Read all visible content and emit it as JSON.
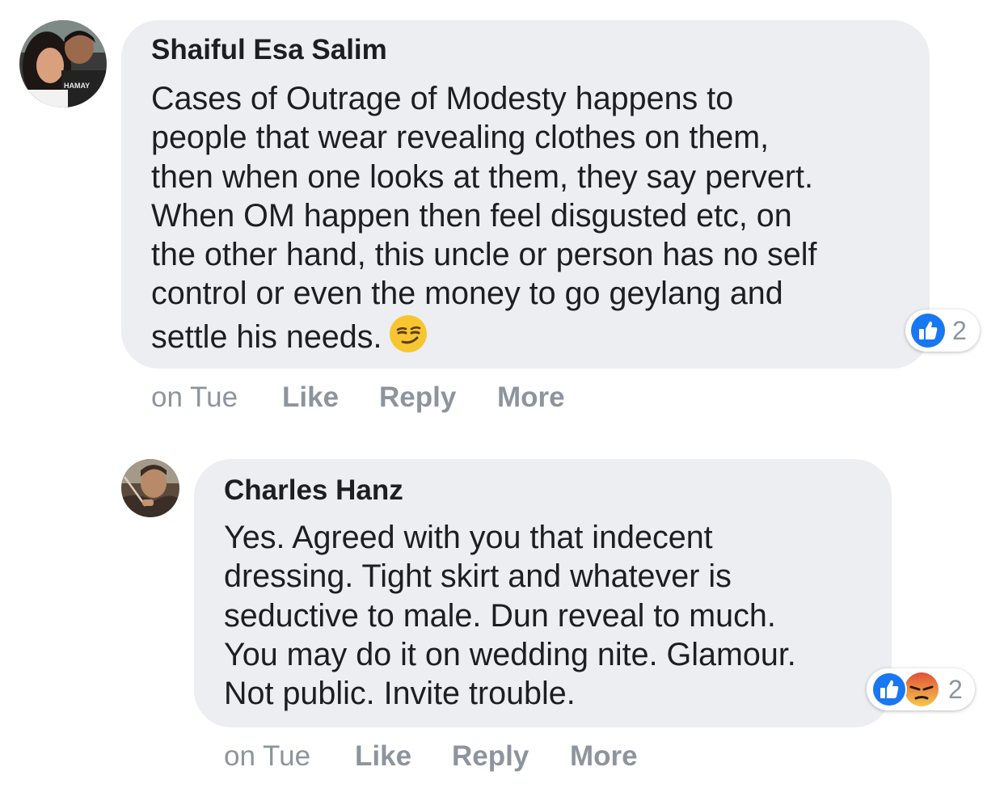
{
  "comments": [
    {
      "author": "Shaiful Esa Salim",
      "text_lines": [
        "Cases of Outrage of Modesty happens to",
        "people that wear revealing clothes on them,",
        "then when one looks at them, they say pervert.",
        "When OM happen then feel disgusted etc, on",
        "the other hand, this uncle or person has no self",
        "control or even the money to go geylang and",
        "settle his needs."
      ],
      "emoji": "smirking-face-emoji",
      "avatar_text": "HAMAY",
      "reactions": {
        "icons": [
          "like-icon"
        ],
        "count": "2"
      },
      "timestamp": "on Tue",
      "actions": {
        "like": "Like",
        "reply": "Reply",
        "more": "More"
      }
    },
    {
      "author": "Charles Hanz",
      "text_lines": [
        "Yes. Agreed with you that indecent",
        "dressing. Tight skirt and whatever is",
        "seductive to male. Dun reveal to much.",
        "You may do it on wedding nite. Glamour.",
        "Not public. Invite trouble."
      ],
      "reactions": {
        "icons": [
          "like-icon",
          "angry-icon"
        ],
        "count": "2"
      },
      "timestamp": "on Tue",
      "actions": {
        "like": "Like",
        "reply": "Reply",
        "more": "More"
      }
    }
  ],
  "colors": {
    "bubble": "#eceef1",
    "text": "#1c1e21",
    "meta": "#8d949e",
    "like_blue": "#1877f2",
    "angry_orange": "#f0883a"
  }
}
